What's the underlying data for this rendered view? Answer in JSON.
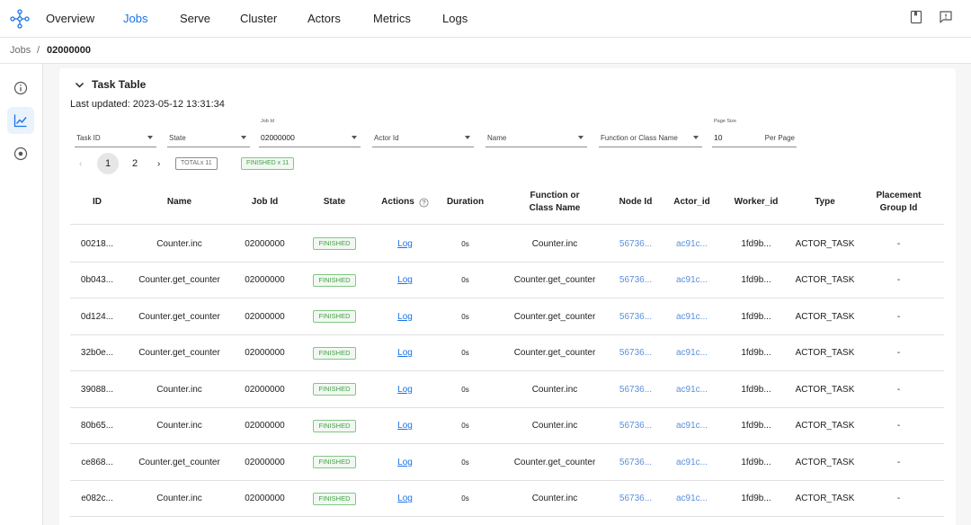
{
  "nav": {
    "items": [
      "Overview",
      "Jobs",
      "Serve",
      "Cluster",
      "Actors",
      "Metrics",
      "Logs"
    ],
    "active": "Jobs",
    "accent": "#1a73e8"
  },
  "breadcrumb": {
    "parent": "Jobs",
    "separator": "/",
    "current": "02000000"
  },
  "sidebar": {
    "items": [
      "info-icon",
      "chart-icon",
      "target-icon"
    ],
    "active": "chart-icon"
  },
  "task_table": {
    "title": "Task Table",
    "last_updated": "Last updated: 2023-05-12 13:31:34",
    "filters": {
      "task_id": "Task ID",
      "state": "State",
      "job_id_label": "Job Id",
      "job_id_value": "02000000",
      "actor_id": "Actor Id",
      "name": "Name",
      "function": "Function or Class Name",
      "page_size_label": "Page Size",
      "page_size_value": "10",
      "page_size_suffix": "Per Page"
    },
    "pagination": {
      "prev": "‹",
      "pages": [
        "1",
        "2"
      ],
      "current": "1",
      "next": "›"
    },
    "tags": {
      "total": "TOTALx 11",
      "finished": "FINISHED x 11"
    },
    "columns": [
      "ID",
      "Name",
      "Job Id",
      "State",
      "Actions",
      "Duration",
      "Function or Class Name",
      "Node Id",
      "Actor_id",
      "Worker_id",
      "Type",
      "Placement Group Id"
    ],
    "rows": [
      {
        "id": "00218...",
        "name": "Counter.inc",
        "job_id": "02000000",
        "state": "FINISHED",
        "action": "Log",
        "duration": "0s",
        "func": "Counter.inc",
        "node": "56736...",
        "actor": "ac91c...",
        "worker": "1fd9b...",
        "type": "ACTOR_TASK",
        "pg": "-"
      },
      {
        "id": "0b043...",
        "name": "Counter.get_counter",
        "job_id": "02000000",
        "state": "FINISHED",
        "action": "Log",
        "duration": "0s",
        "func": "Counter.get_counter",
        "node": "56736...",
        "actor": "ac91c...",
        "worker": "1fd9b...",
        "type": "ACTOR_TASK",
        "pg": "-"
      },
      {
        "id": "0d124...",
        "name": "Counter.get_counter",
        "job_id": "02000000",
        "state": "FINISHED",
        "action": "Log",
        "duration": "0s",
        "func": "Counter.get_counter",
        "node": "56736...",
        "actor": "ac91c...",
        "worker": "1fd9b...",
        "type": "ACTOR_TASK",
        "pg": "-"
      },
      {
        "id": "32b0e...",
        "name": "Counter.get_counter",
        "job_id": "02000000",
        "state": "FINISHED",
        "action": "Log",
        "duration": "0s",
        "func": "Counter.get_counter",
        "node": "56736...",
        "actor": "ac91c...",
        "worker": "1fd9b...",
        "type": "ACTOR_TASK",
        "pg": "-"
      },
      {
        "id": "39088...",
        "name": "Counter.inc",
        "job_id": "02000000",
        "state": "FINISHED",
        "action": "Log",
        "duration": "0s",
        "func": "Counter.inc",
        "node": "56736...",
        "actor": "ac91c...",
        "worker": "1fd9b...",
        "type": "ACTOR_TASK",
        "pg": "-"
      },
      {
        "id": "80b65...",
        "name": "Counter.inc",
        "job_id": "02000000",
        "state": "FINISHED",
        "action": "Log",
        "duration": "0s",
        "func": "Counter.inc",
        "node": "56736...",
        "actor": "ac91c...",
        "worker": "1fd9b...",
        "type": "ACTOR_TASK",
        "pg": "-"
      },
      {
        "id": "ce868...",
        "name": "Counter.get_counter",
        "job_id": "02000000",
        "state": "FINISHED",
        "action": "Log",
        "duration": "0s",
        "func": "Counter.get_counter",
        "node": "56736...",
        "actor": "ac91c...",
        "worker": "1fd9b...",
        "type": "ACTOR_TASK",
        "pg": "-"
      },
      {
        "id": "e082c...",
        "name": "Counter.inc",
        "job_id": "02000000",
        "state": "FINISHED",
        "action": "Log",
        "duration": "0s",
        "func": "Counter.inc",
        "node": "56736...",
        "actor": "ac91c...",
        "worker": "1fd9b...",
        "type": "ACTOR_TASK",
        "pg": "-"
      }
    ]
  }
}
